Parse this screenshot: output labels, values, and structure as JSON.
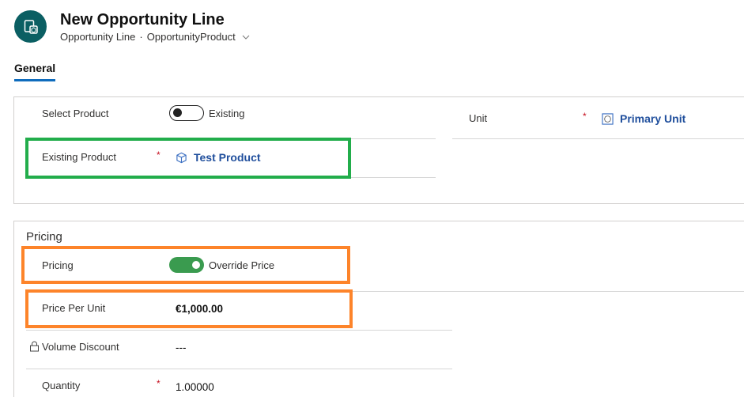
{
  "header": {
    "title": "New Opportunity Line",
    "entity": "Opportunity Line",
    "separator": "·",
    "form_name": "OpportunityProduct",
    "entity_icon": "opportunity-line-icon",
    "form_selector_icon": "chevron-down-icon"
  },
  "tabs": [
    {
      "label": "General",
      "selected": true
    }
  ],
  "general_section": {
    "fields": {
      "select_product": {
        "label": "Select Product",
        "toggle_on": false,
        "toggle_text": "Existing"
      },
      "existing_product": {
        "label": "Existing Product",
        "required": true,
        "required_mark": "*",
        "value": "Test Product",
        "icon": "product-cube-icon"
      },
      "unit": {
        "label": "Unit",
        "required": true,
        "required_mark": "*",
        "value": "Primary Unit",
        "icon": "unit-icon"
      }
    }
  },
  "pricing_section": {
    "title": "Pricing",
    "fields": {
      "pricing": {
        "label": "Pricing",
        "toggle_on": true,
        "toggle_text": "Override Price"
      },
      "price_per_unit": {
        "label": "Price Per Unit",
        "value": "€1,000.00"
      },
      "volume_discount": {
        "label": "Volume Discount",
        "value": "---",
        "locked": true,
        "icon": "lock-icon"
      },
      "quantity": {
        "label": "Quantity",
        "required": true,
        "required_mark": "*",
        "value": "1.00000"
      }
    }
  },
  "highlights": {
    "green": "#22ad4b",
    "orange": "#fd842a"
  }
}
